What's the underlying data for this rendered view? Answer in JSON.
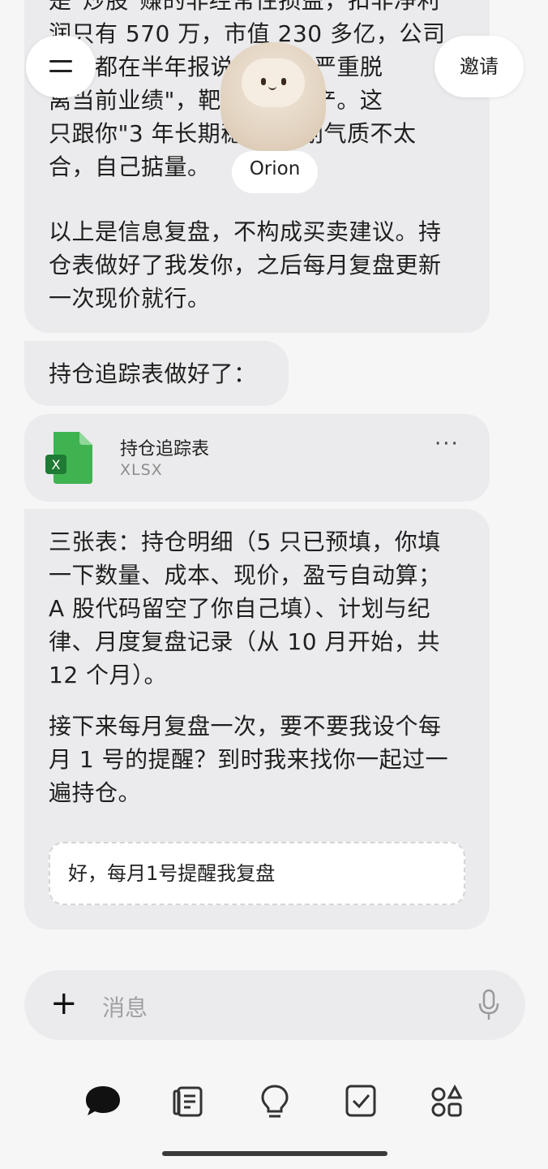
{
  "header": {
    "invite_label": "邀请",
    "assistant_name": "Orion"
  },
  "messages": {
    "msg1": {
      "lines": [
        "是\"炒股\"赚的非经常性损益，扣非净利",
        "润只有 570 万，市值 230 多亿，公司",
        "几年都在半年报说\"这个已严重脱",
        "离当前业绩\"，靶材尚未量产。这",
        "只跟你\"3 年长期稳健\"计划气质不太",
        "合，自己掂量。"
      ],
      "para2": [
        "以上是信息复盘，不构成买卖建议。持",
        "仓表做好了我发你，之后每月复盘更新",
        "一次现价就行。"
      ]
    },
    "msg2": "持仓追踪表做好了：",
    "file": {
      "name": "持仓追踪表",
      "type": "XLSX",
      "icon_letter": "X",
      "more": "···"
    },
    "msg4": {
      "para1": [
        "三张表：持仓明细（5 只已预填，你填",
        "一下数量、成本、现价，盈亏自动算；",
        "A 股代码留空了你自己填）、计划与纪",
        "律、月度复盘记录（从 10 月开始，共",
        "12 个月）。"
      ],
      "para2": [
        "接下来每月复盘一次，要不要我设个每",
        "月 1 号的提醒？到时我来找你一起过一",
        "遍持仓。"
      ],
      "quick_reply": "好，每月1号提醒我复盘"
    }
  },
  "composer": {
    "plus": "+",
    "placeholder": "消息"
  },
  "colors": {
    "bubble": "#ebebed",
    "excel_green": "#3fb34f",
    "background": "#f6f6f7"
  }
}
